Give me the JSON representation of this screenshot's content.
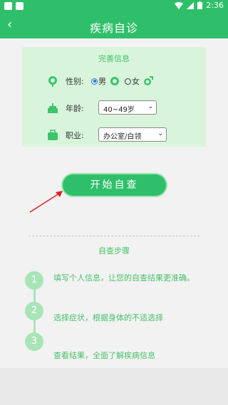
{
  "status_bar": {
    "time": "2:36"
  },
  "app_bar": {
    "back_icon": "chevron-left-icon",
    "title": "疾病自诊"
  },
  "info_card": {
    "heading": "完善信息",
    "gender": {
      "label": "性别:",
      "options": [
        "男",
        "女"
      ],
      "selected": "男"
    },
    "age": {
      "label": "年龄:",
      "value": "40~49岁"
    },
    "occupation": {
      "label": "职业:",
      "value": "办公室/白领"
    }
  },
  "start_button": {
    "label": "开始自查"
  },
  "steps": {
    "title": "自查步骤",
    "items": [
      {
        "number": "1",
        "text": "填写个人信息，让您的自查结果更准确。"
      },
      {
        "number": "2",
        "text": "选择症状，根据身体的不适选择"
      },
      {
        "number": "3",
        "text": "查看结果，全面了解疾病信息"
      }
    ]
  },
  "colors": {
    "primary": "#2fbf6a",
    "card_bg": "#d8f5dc",
    "accent_text": "#49c06c",
    "arrow": "#e02020"
  }
}
